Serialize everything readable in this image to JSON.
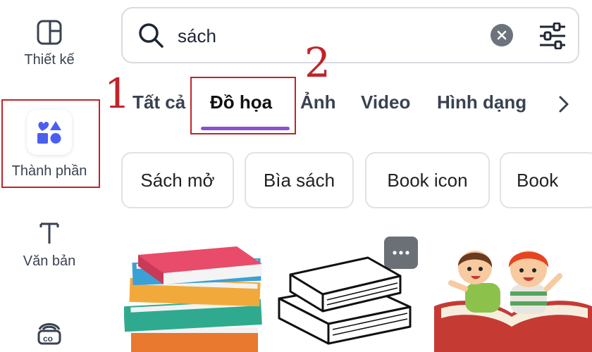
{
  "sidebar": {
    "items": [
      {
        "label": "Thiết kế",
        "icon": "layout-icon"
      },
      {
        "label": "Thành phần",
        "icon": "shapes-icon",
        "active": true
      },
      {
        "label": "Văn bản",
        "icon": "text-icon"
      },
      {
        "label": "",
        "icon": "brand-co-icon"
      }
    ]
  },
  "search": {
    "value": "sách",
    "icon": "search-icon",
    "clear_icon": "close-icon",
    "filter_icon": "filter-sliders-icon"
  },
  "tabs": {
    "items": [
      "Tất cả",
      "Đồ họa",
      "Ảnh",
      "Video",
      "Hình dạng"
    ],
    "active": "Đồ họa",
    "next_icon": "chevron-right-icon"
  },
  "chips": [
    "Sách mở",
    "Bìa sách",
    "Book icon",
    "Book"
  ],
  "annotations": {
    "one": "1",
    "two": "2"
  },
  "results": {
    "items": [
      "stacked-books-graphic",
      "books-outline-graphic",
      "kids-reading-book-graphic"
    ],
    "more_icon": "more-options-icon"
  },
  "colors": {
    "accent": "#8b4fd6",
    "annotation": "#c0242a",
    "icon": "#4a5ff0"
  }
}
